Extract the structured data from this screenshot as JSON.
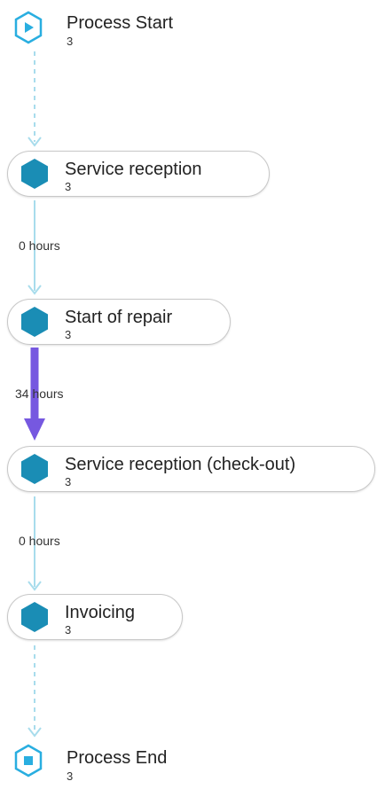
{
  "colors": {
    "activity_hex": "#1a8db5",
    "terminal_stroke": "#29aee0",
    "flow_line": "#a8dcec",
    "slow_line": "#7658e0"
  },
  "process_start": {
    "label": "Process Start",
    "count": "3",
    "icon": "play-icon"
  },
  "activities": [
    {
      "label": "Service reception",
      "count": "3"
    },
    {
      "label": "Start of repair",
      "count": "3"
    },
    {
      "label": "Service reception (check-out)",
      "count": "3"
    },
    {
      "label": "Invoicing",
      "count": "3"
    }
  ],
  "transitions": [
    {
      "label": "0 hours"
    },
    {
      "label": "34 hours"
    },
    {
      "label": "0 hours"
    }
  ],
  "process_end": {
    "label": "Process End",
    "count": "3",
    "icon": "stop-icon"
  }
}
